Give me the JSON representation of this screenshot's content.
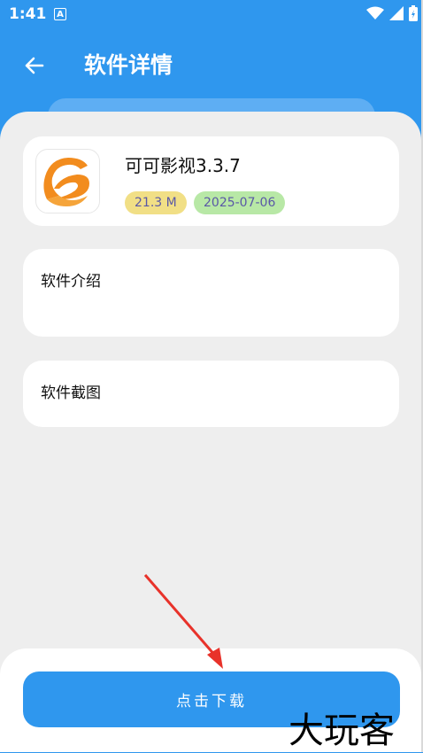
{
  "status_bar": {
    "time": "1:41",
    "notif_letter": "A"
  },
  "header": {
    "title": "软件详情"
  },
  "app": {
    "name": "可可影视3.3.7",
    "size": "21.3 M",
    "date": "2025-07-06",
    "icon": "app-logo-icon"
  },
  "sections": {
    "intro_title": "软件介绍",
    "screenshots_title": "软件截图"
  },
  "download": {
    "label": "点击下载"
  },
  "watermark": "大玩客",
  "colors": {
    "primary": "#2f97ee",
    "background": "#eeeeee",
    "size_badge": "#f1df86",
    "date_badge": "#b8e8a6"
  }
}
